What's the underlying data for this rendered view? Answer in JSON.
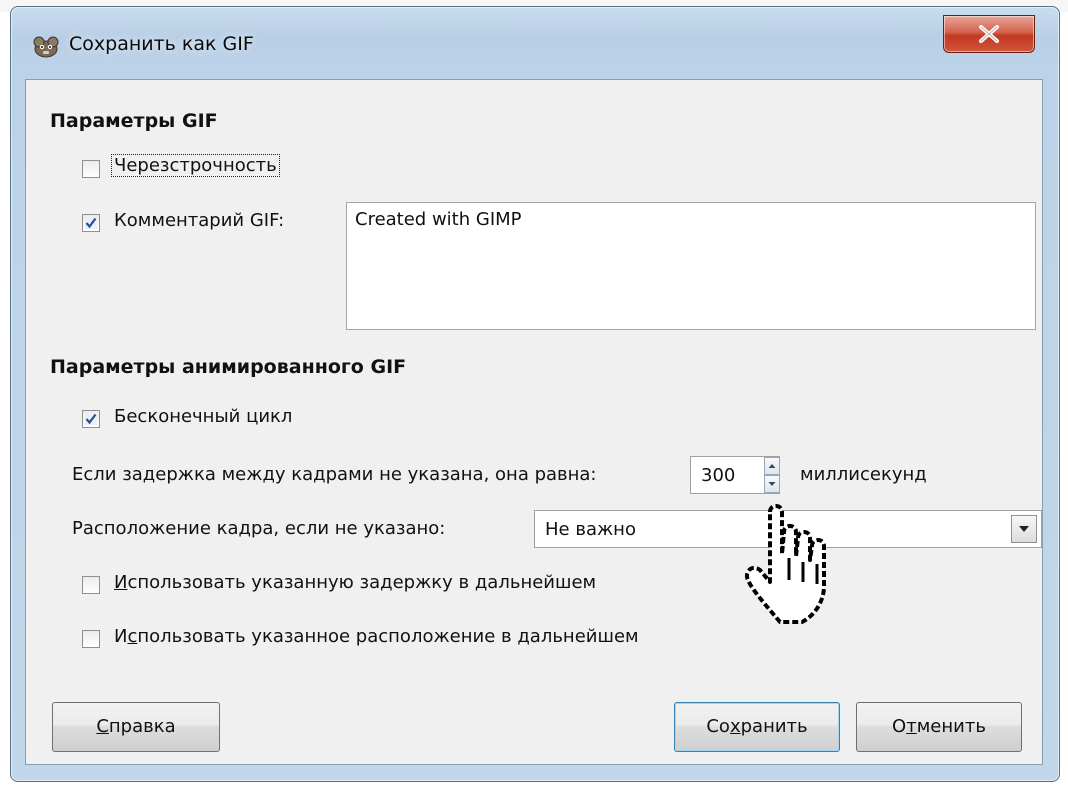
{
  "window": {
    "title": "Сохранить как GIF",
    "close_icon": "close-icon"
  },
  "gif_params": {
    "heading": "Параметры GIF",
    "interlace": {
      "label": "Черезстрочность",
      "checked": false
    },
    "comment": {
      "label": "Комментарий GIF:",
      "checked": true,
      "value": "Created with GIMP"
    }
  },
  "anim_params": {
    "heading": "Параметры анимированного GIF",
    "loop": {
      "label": "Бесконечный цикл",
      "checked": true
    },
    "delay": {
      "label": "Если задержка между кадрами не указана, она равна:",
      "value": "300",
      "unit": "миллисекунд"
    },
    "disposal": {
      "label": "Расположение кадра, если не указано:",
      "selected": "Не важно"
    },
    "use_delay": {
      "pre": "",
      "mnemonic": "И",
      "post": "спользовать указанную задержку в дальнейшем",
      "checked": false
    },
    "use_disposal": {
      "pre": "И",
      "mnemonic": "с",
      "post": "пользовать указанное расположение в дальнейшем",
      "checked": false
    }
  },
  "buttons": {
    "help": {
      "pre": "",
      "mnemonic": "С",
      "post": "правка"
    },
    "save": {
      "pre": "Со",
      "mnemonic": "х",
      "post": "ранить"
    },
    "cancel": {
      "pre": "О",
      "mnemonic": "т",
      "post": "менить"
    }
  },
  "colors": {
    "titlebar": "#bcd2e8",
    "close_button": "#c2381f",
    "dialog_bg": "#f0f0f0",
    "default_button_border": "#3c7fb1"
  }
}
